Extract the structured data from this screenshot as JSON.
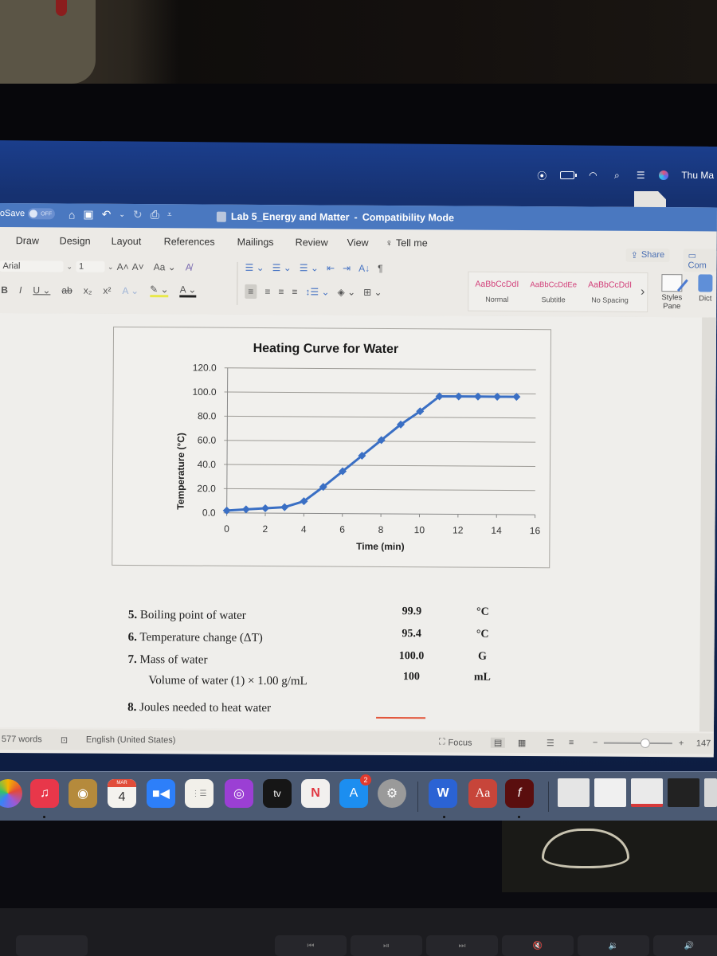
{
  "menubar": {
    "icons": [
      "screen-recording-icon",
      "battery-icon",
      "wifi-icon",
      "spotlight-search-icon",
      "control-center-icon",
      "siri-icon"
    ],
    "clock": "Thu Ma"
  },
  "word": {
    "autosave_label": "oSave",
    "autosave_state": "OFF",
    "doc_title": "Lab 5_Energy and Matter",
    "title_separator": "-",
    "mode": "Compatibility Mode",
    "tabs": [
      "Draw",
      "Design",
      "Layout",
      "References",
      "Mailings",
      "Review",
      "View"
    ],
    "tell_me": "Tell me",
    "share": "Share",
    "comments": "Com",
    "font_name": "Arial",
    "font_size": "1",
    "change_case": "Aa",
    "styles": [
      {
        "sample": "AaBbCcDdI",
        "name": "Normal"
      },
      {
        "sample": "AaBbCcDdEe",
        "name": "Subtitle"
      },
      {
        "sample": "AaBbCcDdI",
        "name": "No Spacing"
      }
    ],
    "styles_pane": "Styles Pane",
    "dictate": "Dict"
  },
  "chart_data": {
    "type": "line",
    "title": "Heating Curve for Water",
    "xlabel": "Time (min)",
    "ylabel": "Temperature (°C)",
    "xlim": [
      0,
      16
    ],
    "ylim": [
      0,
      120
    ],
    "xticks": [
      "0",
      "2",
      "4",
      "6",
      "8",
      "10",
      "12",
      "14",
      "16"
    ],
    "yticks": [
      "0.0",
      "20.0",
      "40.0",
      "60.0",
      "80.0",
      "100.0",
      "120.0"
    ],
    "grid": "horizontal",
    "legend": "none",
    "color": "#3a6fc4",
    "marker": "diamond",
    "series": [
      {
        "name": "Temperature",
        "x": [
          0,
          1,
          2,
          3,
          4,
          5,
          6,
          7,
          8,
          9,
          10,
          11,
          12,
          13,
          14,
          15
        ],
        "y": [
          1.9,
          3.0,
          4.0,
          5.0,
          10.0,
          22.0,
          35.0,
          48.0,
          61.0,
          74.0,
          85.0,
          97.5,
          97.5,
          97.5,
          97.5,
          97.5
        ]
      }
    ]
  },
  "questions": [
    {
      "num": "5.",
      "label": "Boiling point of water",
      "value": "99.9",
      "unit": "°C"
    },
    {
      "num": "6.",
      "label": "Temperature change (ΔT)",
      "value": "95.4",
      "unit": "°C"
    },
    {
      "num": "7.",
      "label": "Mass of water",
      "value": "100.0",
      "unit": "G"
    },
    {
      "num": "",
      "label": "Volume of water (1) × 1.00 g/mL",
      "value": "100",
      "unit": "mL"
    },
    {
      "num": "8.",
      "label": "Joules needed to heat water",
      "value": "",
      "unit": ""
    }
  ],
  "statusbar": {
    "word_count": "577 words",
    "language": "English (United States)",
    "focus": "Focus",
    "zoom": "147",
    "zoom_fraction": 0.6
  },
  "dock": {
    "calendar_month": "MAR",
    "calendar_day": "4",
    "appstore_badge": "2",
    "tv_label": "tv",
    "word_label": "W",
    "dictionary_label": "Aa",
    "flash_label": "f"
  },
  "keyboard": {
    "keys": [
      "",
      "⏮",
      "⏯",
      "⏭",
      "🔇",
      "🔉",
      "🔊"
    ]
  }
}
